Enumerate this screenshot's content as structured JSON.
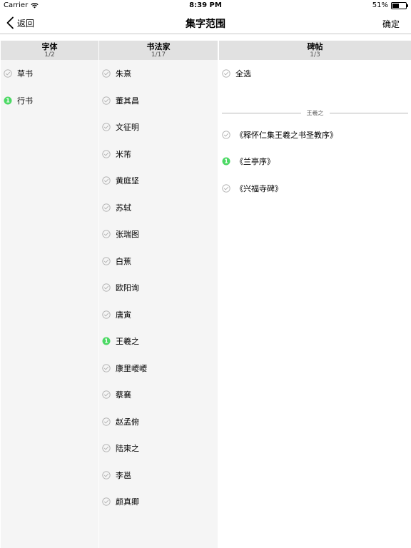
{
  "status_bar": {
    "carrier": "Carrier",
    "time": "8:39 PM",
    "battery": "51%",
    "battery_level": 0.51
  },
  "nav": {
    "back_label": "返回",
    "title": "集字范围",
    "confirm_label": "确定"
  },
  "columns": {
    "font": {
      "title": "字体",
      "count": "1/2",
      "items": [
        {
          "label": "草书",
          "selected": false
        },
        {
          "label": "行书",
          "selected": true,
          "badge": "1"
        }
      ]
    },
    "artist": {
      "title": "书法家",
      "count": "1/17",
      "items": [
        {
          "label": "朱熹",
          "selected": false
        },
        {
          "label": "董其昌",
          "selected": false
        },
        {
          "label": "文征明",
          "selected": false
        },
        {
          "label": "米芾",
          "selected": false
        },
        {
          "label": "黄庭坚",
          "selected": false
        },
        {
          "label": "苏轼",
          "selected": false
        },
        {
          "label": "张瑞图",
          "selected": false
        },
        {
          "label": "白蕉",
          "selected": false
        },
        {
          "label": "欧阳询",
          "selected": false
        },
        {
          "label": "唐寅",
          "selected": false
        },
        {
          "label": "王羲之",
          "selected": true,
          "badge": "1"
        },
        {
          "label": "康里巎巎",
          "selected": false
        },
        {
          "label": "蔡襄",
          "selected": false
        },
        {
          "label": "赵孟俯",
          "selected": false
        },
        {
          "label": "陆柬之",
          "selected": false
        },
        {
          "label": "李邕",
          "selected": false
        },
        {
          "label": "颜真卿",
          "selected": false
        }
      ]
    },
    "tie": {
      "title": "碑帖",
      "count": "1/3",
      "select_all": "全选",
      "group_label": "王羲之",
      "items": [
        {
          "label": "《释怀仁集王羲之书圣教序》",
          "selected": false
        },
        {
          "label": "《兰亭序》",
          "selected": true,
          "badge": "1"
        },
        {
          "label": "《兴福寺碑》",
          "selected": false
        }
      ]
    }
  },
  "colors": {
    "accent": "#4cd964",
    "unchecked": "#b0b0b0",
    "header_bg": "#e1e1e1",
    "column_bg": "#f5f5f5"
  }
}
